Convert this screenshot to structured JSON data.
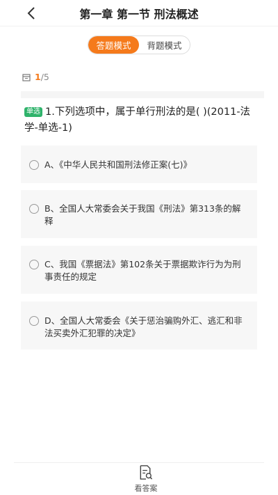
{
  "header": {
    "title": "第一章 第一节 刑法概述",
    "back_icon": "chevron-left-icon"
  },
  "mode_toggle": {
    "answer_mode_label": "答题模式",
    "recite_mode_label": "背题模式",
    "selected": "答题模式"
  },
  "progress": {
    "current": "1",
    "total": "/5",
    "icon": "calendar-icon"
  },
  "question": {
    "type_badge": "单选",
    "text": "1.下列选项中，属于单行刑法的是(      )(2011-法学-单选-1)"
  },
  "options": [
    {
      "label": "A、《中华人民共和国刑法修正案(七)》"
    },
    {
      "label": "B、全国人大常委会关于我国《刑法》第313条的解释"
    },
    {
      "label": "C、我国《票据法》第102条关于票据欺诈行为为刑事责任的规定"
    },
    {
      "label": "D、全国人大常委会《关于惩治骗购外汇、逃汇和非法买卖外汇犯罪的决定》"
    }
  ],
  "bottom_bar": {
    "view_answer_label": "看答案",
    "view_answer_icon": "document-search-icon"
  },
  "colors": {
    "accent": "#f57a1b",
    "badge_green": "#2fb36b",
    "option_bg": "#f7f7f7"
  }
}
